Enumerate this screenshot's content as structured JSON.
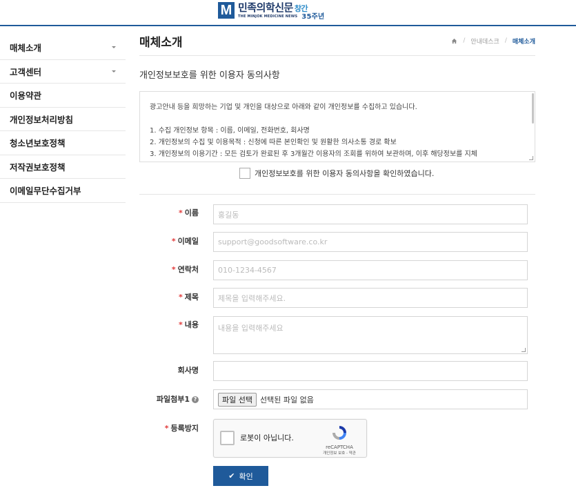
{
  "logo": {
    "mark": "M",
    "title": "민족의학신문",
    "accent": "창간",
    "subtitle": "THE MINJOK MEDICINE NEWS",
    "anniversary": "35주년"
  },
  "sidebar": {
    "items": [
      {
        "label": "매체소개",
        "has_caret": true
      },
      {
        "label": "고객센터",
        "has_caret": true
      },
      {
        "label": "이용약관",
        "has_caret": false
      },
      {
        "label": "개인정보처리방침",
        "has_caret": false
      },
      {
        "label": "청소년보호정책",
        "has_caret": false
      },
      {
        "label": "저작권보호정책",
        "has_caret": false
      },
      {
        "label": "이메일무단수집거부",
        "has_caret": false
      }
    ]
  },
  "page": {
    "title": "매체소개"
  },
  "breadcrumb": {
    "home_icon": "home-icon",
    "items": [
      "안내데스크",
      "매체소개"
    ]
  },
  "agreement": {
    "title": "개인정보보호를 위한 이용자 동의사항",
    "lines": [
      "광고안내 등을 희망하는 기업 및 개인을 대상으로 아래와 같이 개인정보를 수집하고 있습니다.",
      "1. 수집 개인정보 항목 : 이름, 이메일, 전화번호, 회사명",
      "2. 개인정보의 수집 및 이용목적 : 신청에 따른 본인확인 및 원활한 의사소통 경로 확보",
      "3. 개인정보의 이용기간 : 모든 검토가 완료된 후 3개월간 이용자의 조회를 위하여 보관하며, 이후 해당정보를 지체"
    ],
    "checkbox_label": "개인정보보호를 위한 이용자 동의사항을 확인하였습니다."
  },
  "form": {
    "name": {
      "label": "이름",
      "required": true,
      "placeholder": "홍길동"
    },
    "email": {
      "label": "이메일",
      "required": true,
      "placeholder": "support@goodsoftware.co.kr"
    },
    "phone": {
      "label": "연락처",
      "required": true,
      "placeholder": "010-1234-4567"
    },
    "subject": {
      "label": "제목",
      "required": true,
      "placeholder": "제목을 입력해주세요."
    },
    "content": {
      "label": "내용",
      "required": true,
      "placeholder": "내용을 입력해주세요"
    },
    "company": {
      "label": "회사명",
      "required": false,
      "placeholder": ""
    },
    "file": {
      "label": "파일첨부1",
      "button": "파일 선택",
      "status": "선택된 파일 없음",
      "help_icon": "question-circle-icon"
    },
    "spam": {
      "label": "등록방지",
      "required": true
    },
    "recaptcha": {
      "text": "로봇이 아닙니다.",
      "brand": "reCAPTCHA",
      "links": "개인정보 보호 - 약관"
    },
    "submit": {
      "label": "확인",
      "icon": "check-icon"
    }
  },
  "colors": {
    "accent": "#1f5a9a",
    "required": "#e23b3b"
  }
}
